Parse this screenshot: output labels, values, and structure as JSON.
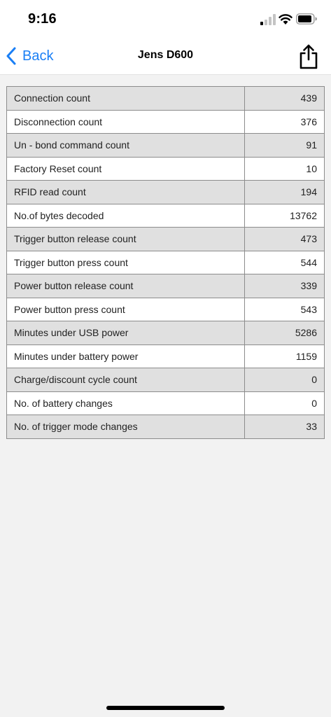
{
  "status_bar": {
    "time": "9:16"
  },
  "nav": {
    "back_label": "Back",
    "title": "Jens D600"
  },
  "colors": {
    "accent": "#1a7ff5",
    "row_shaded": "#e0e0e0",
    "row_plain": "#ffffff",
    "background": "#f2f2f2"
  },
  "icons": {
    "back": "chevron-left-icon",
    "share": "share-icon",
    "signal": "cellular-signal-icon",
    "wifi": "wifi-icon",
    "battery": "battery-icon"
  },
  "stats": {
    "rows": [
      {
        "label": "Connection count",
        "value": "439"
      },
      {
        "label": "Disconnection count",
        "value": "376"
      },
      {
        "label": "Un - bond command count",
        "value": "91"
      },
      {
        "label": "Factory Reset count",
        "value": "10"
      },
      {
        "label": "RFID read count",
        "value": "194"
      },
      {
        "label": "No.of bytes decoded",
        "value": "13762"
      },
      {
        "label": "Trigger button release count",
        "value": "473"
      },
      {
        "label": "Trigger button press count",
        "value": "544"
      },
      {
        "label": "Power button release count",
        "value": "339"
      },
      {
        "label": "Power button press count",
        "value": "543"
      },
      {
        "label": "Minutes under USB power",
        "value": "5286"
      },
      {
        "label": "Minutes under battery power",
        "value": "1159"
      },
      {
        "label": "Charge/discount cycle count",
        "value": "0"
      },
      {
        "label": "No. of battery changes",
        "value": "0"
      },
      {
        "label": "No. of trigger mode changes",
        "value": "33"
      }
    ]
  }
}
